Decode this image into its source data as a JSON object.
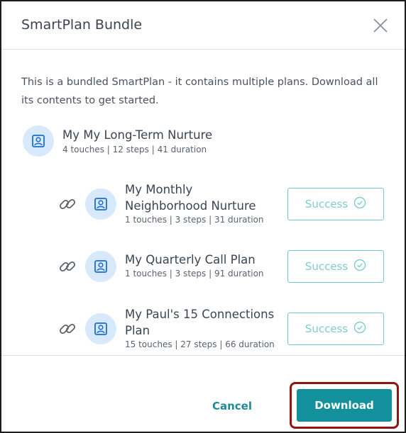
{
  "modal": {
    "title": "SmartPlan Bundle",
    "intro": "This is a bundled SmartPlan - it contains multiple plans. Download all its contents to get started."
  },
  "parent_plan": {
    "name": "My My Long-Term Nurture",
    "meta": "4 touches | 12 steps | 41 duration",
    "icon": "person-card-icon"
  },
  "child_plans": [
    {
      "name_line1": "My Monthly",
      "name_line2": "Neighborhood Nurture",
      "meta": "1 touches | 3 steps | 31 duration",
      "status": "Success"
    },
    {
      "name_line1": "My Quarterly Call Plan",
      "name_line2": "",
      "meta": "1 touches | 3 steps | 91 duration",
      "status": "Success"
    },
    {
      "name_line1": "My Paul's 15 Connections",
      "name_line2": "Plan",
      "meta": "15 touches | 27 steps | 66 duration",
      "status": "Success"
    }
  ],
  "footer": {
    "cancel_label": "Cancel",
    "download_label": "Download"
  },
  "colors": {
    "accent": "#12919c",
    "success_border": "#6fc9c9",
    "avatar_bg": "#d8e9fb",
    "highlight_ring": "#8f1414"
  }
}
